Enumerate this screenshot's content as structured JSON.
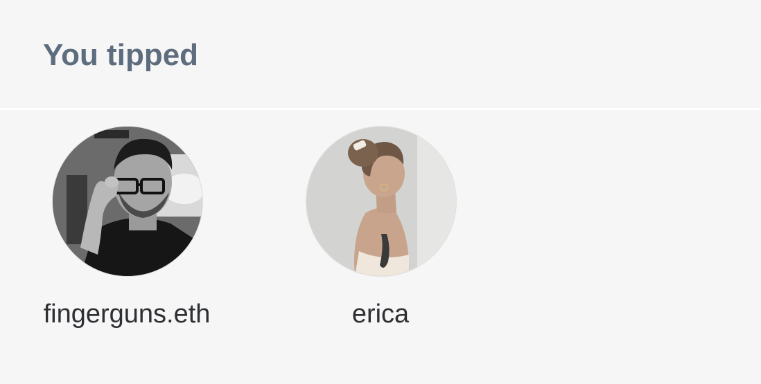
{
  "section": {
    "title": "You tipped"
  },
  "tipped_users": [
    {
      "name": "fingerguns.eth",
      "avatar": "portrait-man-glasses-bw"
    },
    {
      "name": "erica",
      "avatar": "portrait-woman-profile"
    }
  ],
  "colors": {
    "background": "#f6f6f6",
    "title": "#5d6d7e",
    "username": "#2d2f33",
    "divider": "#ffffff"
  }
}
